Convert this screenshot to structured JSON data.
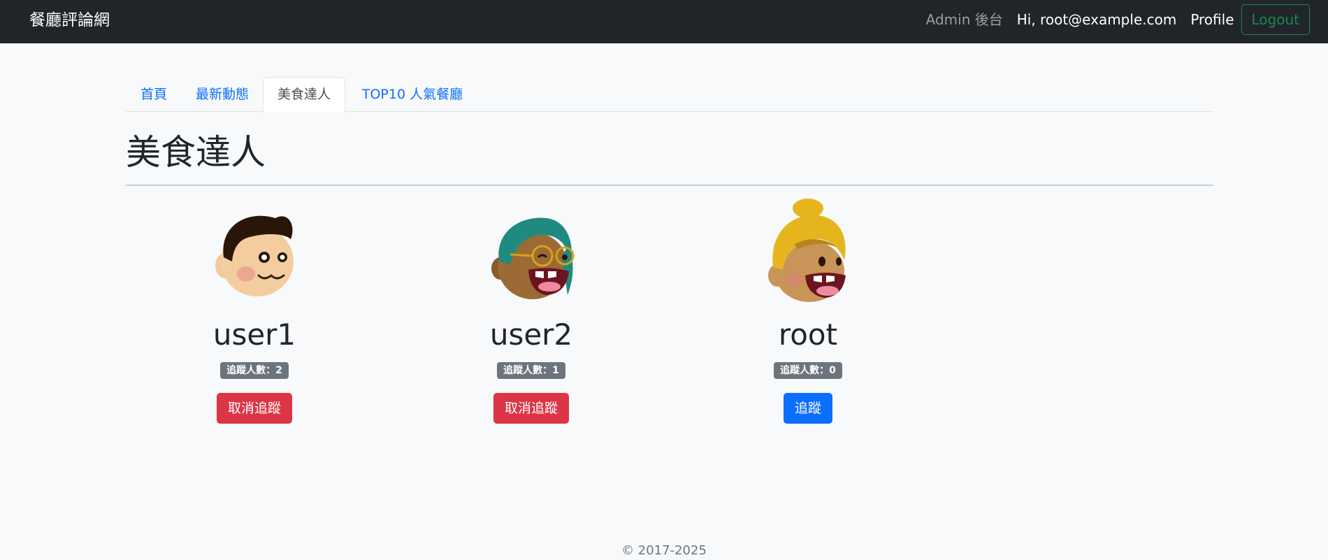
{
  "navbar": {
    "brand": "餐廳評論網",
    "admin_link": "Admin 後台",
    "greeting": "Hi, root@example.com",
    "profile_link": "Profile",
    "logout_label": "Logout"
  },
  "tabs": [
    {
      "label": "首頁",
      "active": false
    },
    {
      "label": "最新動態",
      "active": false
    },
    {
      "label": "美食達人",
      "active": true
    },
    {
      "label": "TOP10 人氣餐廳",
      "active": false
    }
  ],
  "page_title": "美食達人",
  "users": [
    {
      "name": "user1",
      "followers": "追蹤人數：2",
      "action": "取消追蹤",
      "action_type": "danger",
      "avatar": "boy-avatar-icon"
    },
    {
      "name": "user2",
      "followers": "追蹤人數：1",
      "action": "取消追蹤",
      "action_type": "danger",
      "avatar": "glasses-avatar-icon"
    },
    {
      "name": "root",
      "followers": "追蹤人數：0",
      "action": "追蹤",
      "action_type": "primary",
      "avatar": "bun-hair-avatar-icon"
    }
  ],
  "colors": {
    "navbar_bg": "#212529",
    "link": "#0d6efd",
    "danger": "#dc3545",
    "primary": "#0d6efd",
    "success_outline": "#198754",
    "badge": "#6c757d"
  },
  "footer": "© 2017-2025"
}
